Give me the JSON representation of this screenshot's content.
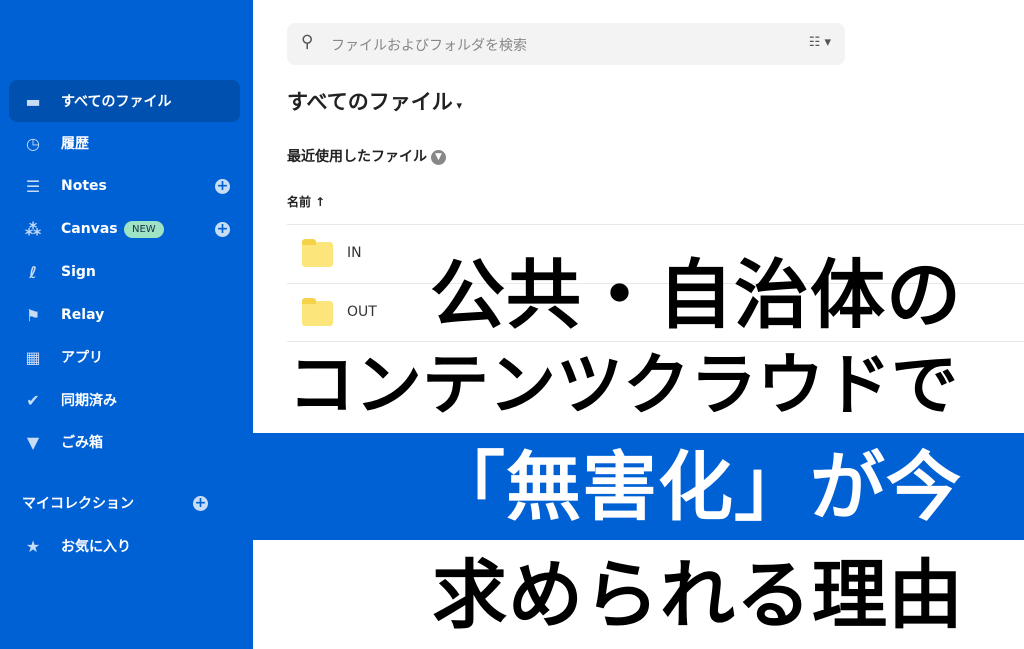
{
  "sidebar": {
    "items": [
      {
        "label": "すべてのファイル",
        "icon": "folder-icon"
      },
      {
        "label": "履歴",
        "icon": "clock-icon"
      },
      {
        "label": "Notes",
        "icon": "notes-icon"
      },
      {
        "label": "Canvas",
        "icon": "canvas-icon",
        "badge": "NEW"
      },
      {
        "label": "Sign",
        "icon": "signature-icon"
      },
      {
        "label": "Relay",
        "icon": "relay-icon"
      },
      {
        "label": "アプリ",
        "icon": "grid-icon"
      },
      {
        "label": "同期済み",
        "icon": "check-circle-icon"
      },
      {
        "label": "ごみ箱",
        "icon": "trash-icon"
      }
    ],
    "collections_label": "マイコレクション",
    "favorites_label": "お気に入り"
  },
  "search": {
    "placeholder": "ファイルおよびフォルダを検索"
  },
  "main": {
    "title": "すべてのファイル",
    "recent_label": "最近使用したファイル",
    "column_name": "名前 ↑",
    "rows": [
      {
        "name": "IN"
      },
      {
        "name": "OUT"
      }
    ]
  },
  "headline": {
    "line1": "公共・自治体の",
    "line2": "コンテンツクラウドで",
    "line3": "「無害化」が今",
    "line4": "求められる理由"
  },
  "colors": {
    "sidebar": "#0061d5",
    "folder": "#fce57a"
  }
}
